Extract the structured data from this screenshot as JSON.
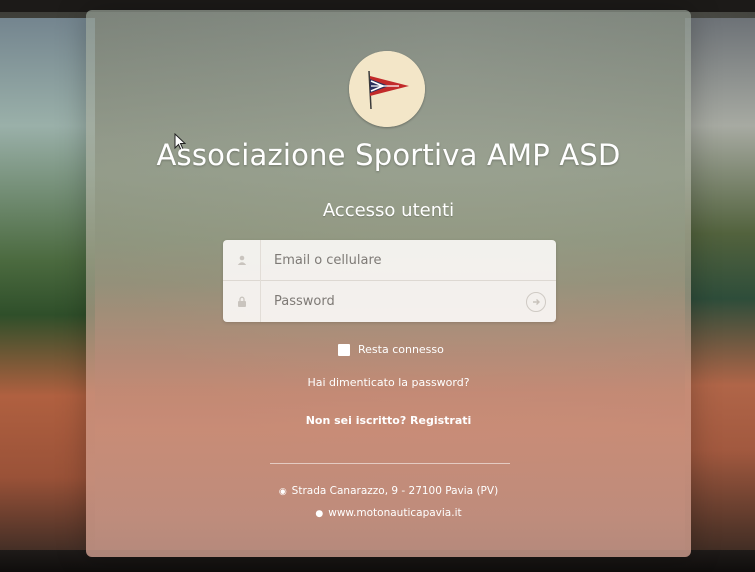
{
  "app": {
    "title": "Associazione Sportiva AMP ASD",
    "subtitle": "Accesso utenti"
  },
  "logo": {
    "icon": "burgee-flag-logo",
    "colors": {
      "circle": "#f3e6c8",
      "flag_red": "#c22a2a",
      "flag_blue": "#2a2f5c"
    }
  },
  "login": {
    "email_placeholder": "Email o cellulare",
    "email_value": "",
    "password_placeholder": "Password",
    "password_value": "",
    "email_icon": "user-icon",
    "password_icon": "lock-icon",
    "submit_icon": "arrow-right-circle-icon"
  },
  "options": {
    "remember_label": "Resta connesso",
    "remember_checked": false,
    "forgot_link": "Hai dimenticato la password?",
    "register_link": "Non sei iscritto? Registrati"
  },
  "footer": {
    "address": "Strada Canarazzo, 9 - 27100 Pavia (PV)",
    "website": "www.motonauticapavia.it",
    "address_icon": "map-marker-icon",
    "website_icon": "globe-icon"
  }
}
